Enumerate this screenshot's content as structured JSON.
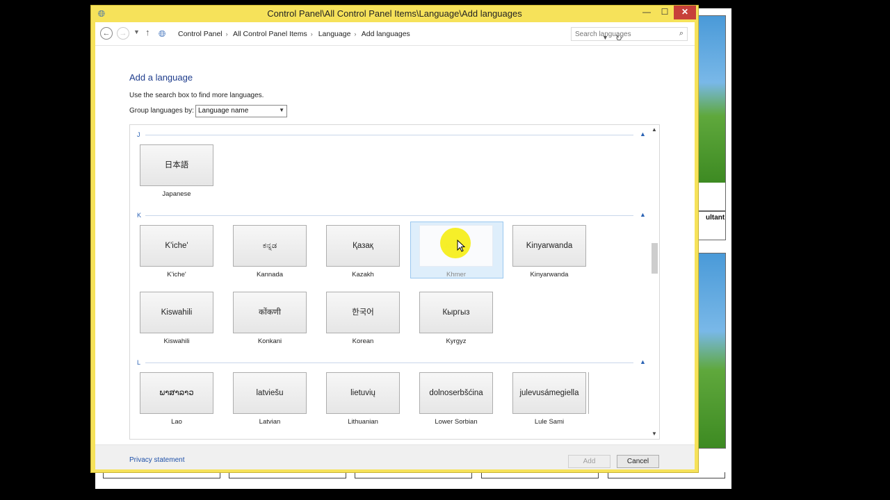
{
  "window": {
    "title": "Control Panel\\All Control Panel Items\\Language\\Add languages",
    "controls": {
      "minimize": "—",
      "maximize": "☐",
      "close": "✕"
    }
  },
  "address": {
    "crumbs": [
      "Control Panel",
      "All Control Panel Items",
      "Language",
      "Add languages"
    ],
    "search_placeholder": "Search languages"
  },
  "content": {
    "title": "Add a language",
    "instructions": "Use the search box to find more languages.",
    "group_label": "Group languages by:",
    "group_value": "Language name"
  },
  "groups": [
    {
      "letter": "J",
      "items": [
        {
          "native": "日本語",
          "name": "Japanese"
        }
      ]
    },
    {
      "letter": "K",
      "items": [
        {
          "native": "K'iche'",
          "name": "K'iche'"
        },
        {
          "native": "ಕನ್ನಡ",
          "name": "Kannada"
        },
        {
          "native": "Қазақ",
          "name": "Kazakh"
        },
        {
          "native": "ភាសាខ្មែរ",
          "name": "Khmer",
          "selected": true
        },
        {
          "native": "Kinyarwanda",
          "name": "Kinyarwanda"
        },
        {
          "native": "Kiswahili",
          "name": "Kiswahili"
        },
        {
          "native": "कोंकणी",
          "name": "Konkani"
        },
        {
          "native": "한국어",
          "name": "Korean"
        },
        {
          "native": "Кыргыз",
          "name": "Kyrgyz"
        }
      ]
    },
    {
      "letter": "L",
      "items": [
        {
          "native": "ພາສາລາວ",
          "name": "Lao"
        },
        {
          "native": "latviešu",
          "name": "Latvian"
        },
        {
          "native": "lietuvių",
          "name": "Lithuanian"
        },
        {
          "native": "dolnoserbšćina",
          "name": "Lower Sorbian"
        },
        {
          "native": "julevusámegiella",
          "name": "Lule Sami"
        }
      ]
    }
  ],
  "footer": {
    "privacy": "Privacy statement",
    "add": "Add",
    "cancel": "Cancel"
  },
  "background": {
    "partial_text": "ultant"
  },
  "colors": {
    "title_bar": "#f6e25a",
    "link": "#1e50a8",
    "accent": "#2a62b4",
    "close_button": "#c7403a",
    "selection": "#deeefb",
    "cursor_highlight": "#f6ee1d"
  },
  "icons": {
    "title": "globe-icon",
    "back": "back-arrow-icon",
    "forward": "forward-arrow-icon",
    "up": "up-arrow-icon",
    "refresh": "refresh-icon",
    "search": "search-icon"
  }
}
